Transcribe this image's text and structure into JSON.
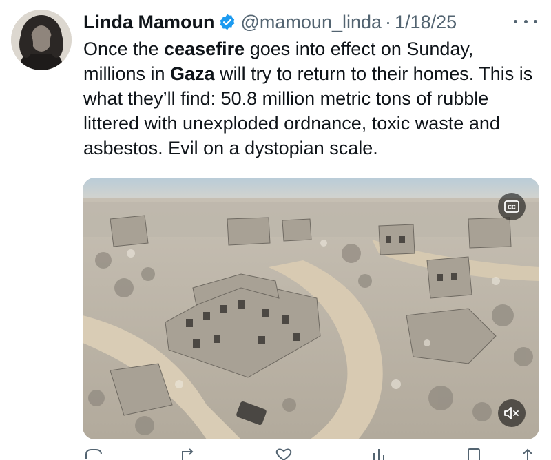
{
  "author": {
    "name": "Linda Mamoun",
    "handle": "@mamoun_linda",
    "separator": "·",
    "date": "1/18/25"
  },
  "tweet": {
    "p1": "Once the ",
    "b1": "ceasefire",
    "p2": " goes into effect on Sunday, millions in ",
    "b2": "Gaza",
    "p3": " will try to return to their homes. This is what they’ll find: 50.8 million metric tons of rubble littered with unexploded ordnance, toxic waste and asbestos. Evil on a dystopian scale."
  },
  "media": {
    "type": "video",
    "cc_label": "CC"
  },
  "icons": [
    "verified-badge-icon",
    "more-options-icon",
    "closed-captions-icon",
    "muted-speaker-icon",
    "reply-icon",
    "retweet-icon",
    "like-icon",
    "views-icon",
    "bookmark-icon",
    "share-icon"
  ],
  "colors": {
    "text": "#0f1419",
    "secondary": "#536471",
    "verified": "#1d9bf0"
  }
}
